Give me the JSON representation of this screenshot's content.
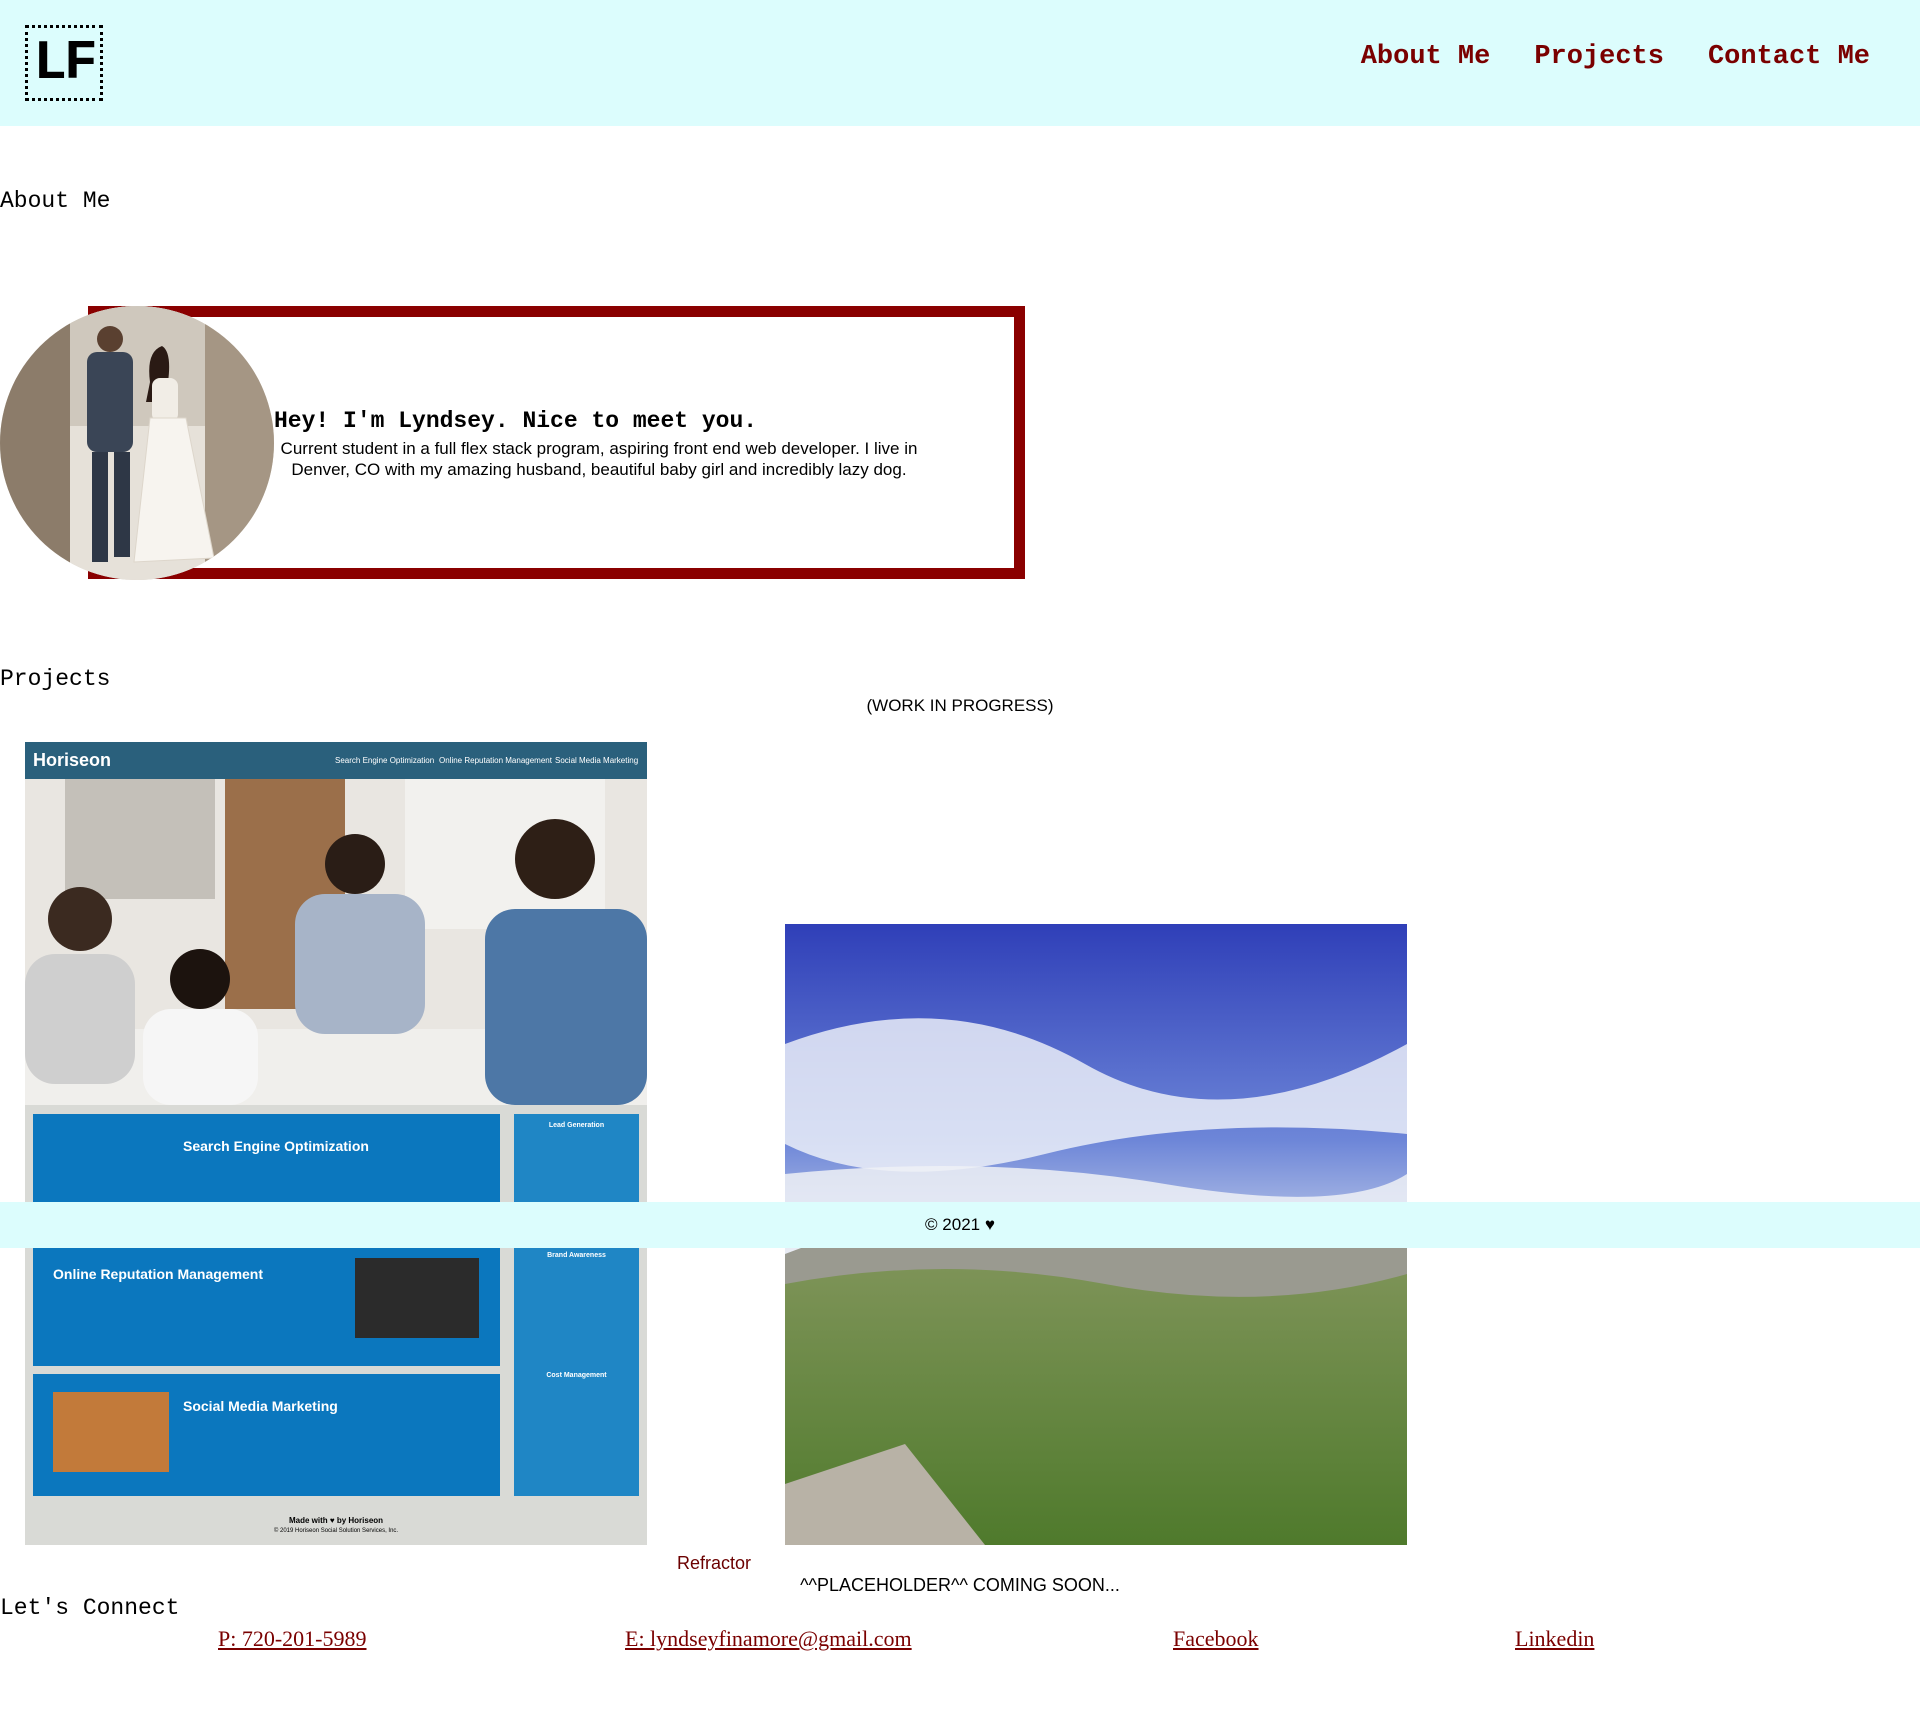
{
  "header": {
    "logo": "LF",
    "nav": [
      "About Me",
      "Projects",
      "Contact Me"
    ]
  },
  "about": {
    "heading": "About Me",
    "greeting": "Hey! I'm Lyndsey. Nice to meet you.",
    "bio": "Current student in a full flex stack program, aspiring front end web developer. I live in Denver, CO with my amazing husband, beautiful baby girl and incredibly lazy dog."
  },
  "projects": {
    "heading": "Projects",
    "status": "(WORK IN PROGRESS)",
    "horiseon": {
      "brand": "Horiseon",
      "nav": [
        "Search Engine Optimization",
        "Online Reputation Management",
        "Social Media Marketing"
      ],
      "cards": [
        "Search Engine Optimization",
        "Online Reputation Management",
        "Social Media Marketing"
      ],
      "side_cards": [
        "Lead Generation",
        "Brand Awareness",
        "Cost Management"
      ],
      "footer": "Made with ♥ by Horiseon",
      "copyright": "© 2019 Horiseon Social Solution Services, Inc."
    },
    "project_link": "Refractor",
    "placeholder_caption": "^^PLACEHOLDER^^ COMING SOON..."
  },
  "footer": {
    "text": "© 2021 ♥"
  },
  "connect": {
    "heading": "Let's Connect",
    "phone": "P: 720-201-5989",
    "email": "E: lyndseyfinamore@gmail.com",
    "facebook": "Facebook",
    "linkedin": "Linkedin"
  },
  "colors": {
    "header_bg": "#dcfdfd",
    "accent": "#7a0000",
    "card_border": "#8a0000"
  }
}
